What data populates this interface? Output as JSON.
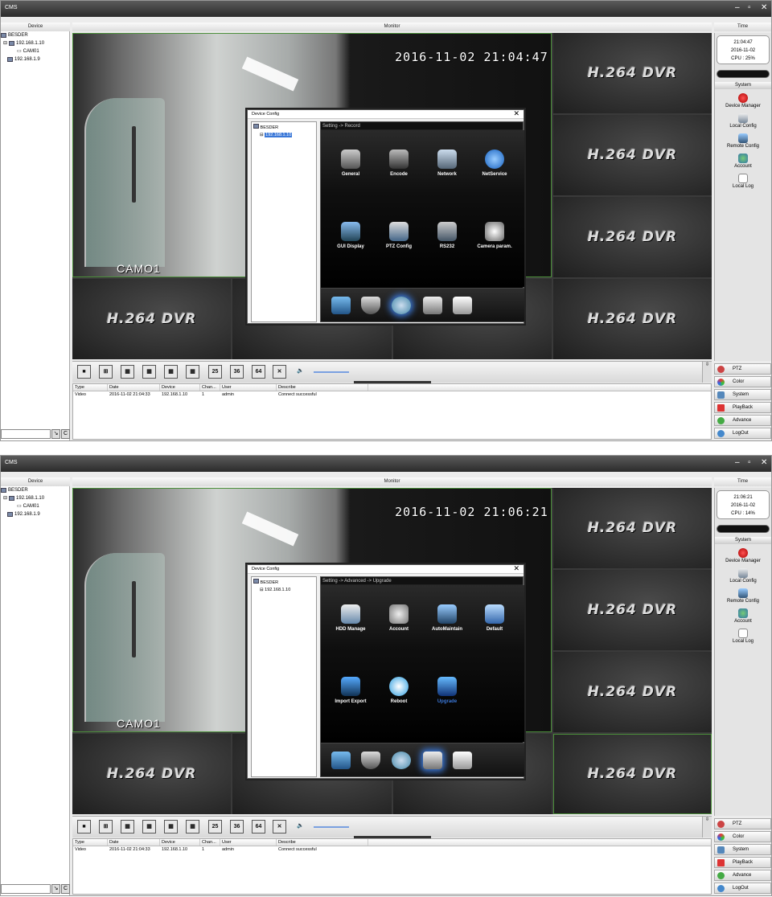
{
  "screens": [
    {
      "app_title": "CMS",
      "header": {
        "device": "Device",
        "monitor": "Monitor",
        "time": "Time"
      },
      "tree": [
        "BESDER",
        "192.168.1.10",
        "CAM01",
        "192.168.1.9"
      ],
      "timestamp": "2016-11-02 21:04:47",
      "cam_label": "CAMO1",
      "tile_label": "H.264 DVR",
      "clock": {
        "time": "21:04:47",
        "date": "2016-11-02",
        "cpu": "CPU : 25%"
      },
      "system_label": "System",
      "right_menu": [
        "Device Manager",
        "Local Config",
        "Remote Config",
        "Account",
        "Local Log"
      ],
      "toolbar": [
        "25",
        "36",
        "64"
      ],
      "log_headers": [
        "Type",
        "Date",
        "Device",
        "Chan...",
        "User",
        "Describe"
      ],
      "log_row": [
        "Video",
        "2016-11-02 21:04:33",
        "192.168.1.10",
        "1",
        "admin",
        "Connect successful"
      ],
      "bottom_buttons": [
        "PTZ",
        "Color",
        "System",
        "PlayBack",
        "Advance",
        "LogOut"
      ],
      "dialog": {
        "title": "Device Config",
        "tree_root": "BESDER",
        "tree_child": "192.168.1.10",
        "breadcrumb": "Setting -> Record",
        "items": [
          "General",
          "Encode",
          "Network",
          "NetService",
          "GUI Display",
          "PTZ Config",
          "RS232",
          "Camera param."
        ]
      }
    },
    {
      "app_title": "CMS",
      "header": {
        "device": "Device",
        "monitor": "Monitor",
        "time": "Time"
      },
      "tree": [
        "BESDER",
        "192.168.1.10",
        "CAM01",
        "192.168.1.9"
      ],
      "timestamp": "2016-11-02 21:06:21",
      "cam_label": "CAMO1",
      "tile_label": "H.264 DVR",
      "clock": {
        "time": "21:06:21",
        "date": "2016-11-02",
        "cpu": "CPU : 14%"
      },
      "system_label": "System",
      "right_menu": [
        "Device Manager",
        "Local Config",
        "Remote Config",
        "Account",
        "Local Log"
      ],
      "toolbar": [
        "25",
        "36",
        "64"
      ],
      "log_headers": [
        "Type",
        "Date",
        "Device",
        "Chan...",
        "User",
        "Describe"
      ],
      "log_row": [
        "Video",
        "2016-11-02 21:04:33",
        "192.168.1.10",
        "1",
        "admin",
        "Connect successful"
      ],
      "bottom_buttons": [
        "PTZ",
        "Color",
        "System",
        "PlayBack",
        "Advance",
        "LogOut"
      ],
      "dialog": {
        "title": "Device Config",
        "tree_root": "BESDER",
        "tree_child": "192.168.1.10",
        "breadcrumb": "Setting -> Advanced -> Upgrade",
        "items": [
          "HDD Manage",
          "Account",
          "AutoMaintain",
          "Default",
          "Import Export",
          "Reboot",
          "Upgrade"
        ]
      }
    }
  ],
  "colors": {
    "accent": "#3b78d8",
    "tile_border": "#4b8f3a",
    "panel": "#000000"
  }
}
